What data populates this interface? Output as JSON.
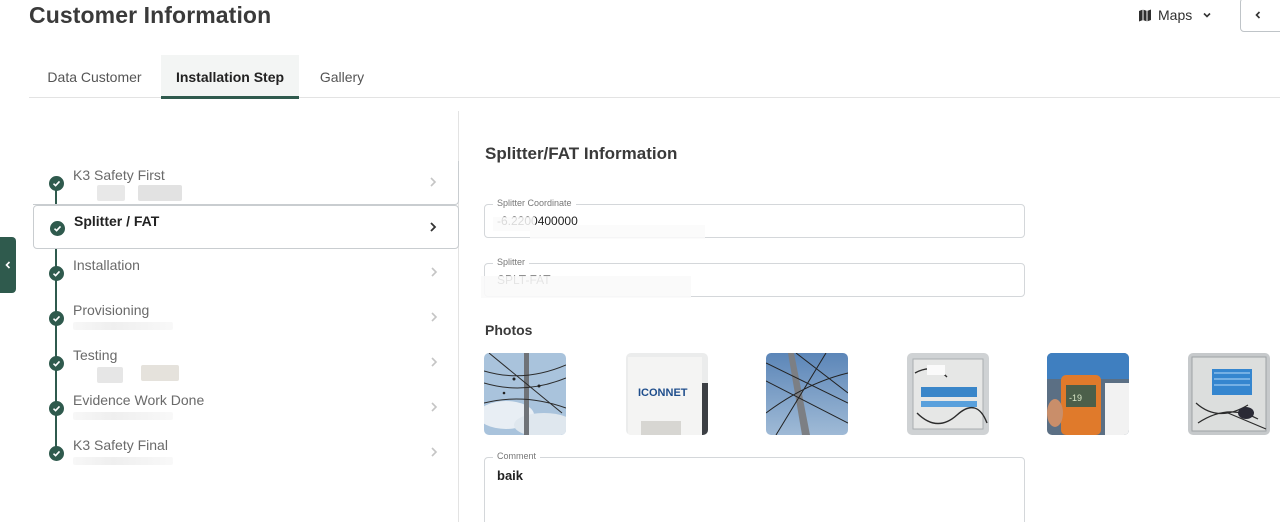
{
  "header": {
    "title": "Customer Information",
    "maps_label": "Maps"
  },
  "tabs": [
    {
      "label": "Data Customer"
    },
    {
      "label": "Installation Step",
      "active": true
    },
    {
      "label": "Gallery"
    }
  ],
  "steps": [
    {
      "label": "K3 Safety First"
    },
    {
      "label": "Splitter / FAT",
      "active": true
    },
    {
      "label": "Installation"
    },
    {
      "label": "Provisioning"
    },
    {
      "label": "Testing"
    },
    {
      "label": "Evidence Work Done"
    },
    {
      "label": "K3 Safety Final"
    }
  ],
  "section": {
    "title": "Splitter/FAT Information",
    "splitter_coordinate_label": "Splitter Coordinate",
    "splitter_coordinate_value": "-6.2200400000",
    "splitter_label": "Splitter",
    "splitter_value": "SPLT-FAT",
    "photos_title": "Photos",
    "comment_label": "Comment",
    "comment_value": "baik"
  },
  "photos": [
    {
      "name": "photo-pole-sky"
    },
    {
      "name": "photo-iconnet-box",
      "text": "ICONNET"
    },
    {
      "name": "photo-pole-wires"
    },
    {
      "name": "photo-splitter-open"
    },
    {
      "name": "photo-power-meter",
      "text": "-19"
    },
    {
      "name": "photo-splitter-closeup"
    }
  ],
  "colors": {
    "accent": "#2f5a4d",
    "border": "#d4d7da"
  }
}
